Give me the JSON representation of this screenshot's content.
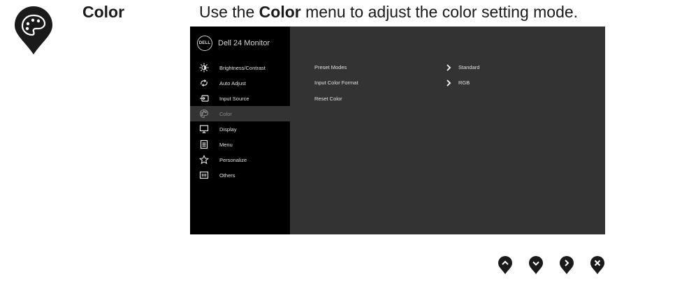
{
  "heading": {
    "title": "Color",
    "desc_before": "Use the ",
    "desc_bold": "Color",
    "desc_after": " menu to adjust the color setting mode."
  },
  "osd": {
    "logo_text": "DELL",
    "title": "Dell 24 Monitor",
    "menu": [
      {
        "label": "Brightness/Contrast",
        "icon": "brightness-icon",
        "active": false
      },
      {
        "label": "Auto Adjust",
        "icon": "auto-adjust-icon",
        "active": false
      },
      {
        "label": "Input Source",
        "icon": "input-source-icon",
        "active": false
      },
      {
        "label": "Color",
        "icon": "palette-icon",
        "active": true
      },
      {
        "label": "Display",
        "icon": "display-icon",
        "active": false
      },
      {
        "label": "Menu",
        "icon": "menu-icon",
        "active": false
      },
      {
        "label": "Personalize",
        "icon": "star-icon",
        "active": false
      },
      {
        "label": "Others",
        "icon": "others-icon",
        "active": false
      }
    ],
    "panel": [
      {
        "label": "Preset Modes",
        "value": "Standard",
        "has_arrow": true
      },
      {
        "label": "Input Color Format",
        "value": "RGB",
        "has_arrow": true
      },
      {
        "label": "Reset Color",
        "value": "",
        "has_arrow": false
      }
    ]
  },
  "nav_buttons": [
    "up-button",
    "down-button",
    "right-button",
    "close-button"
  ],
  "colors": {
    "osd_sidebar": "#000000",
    "osd_panel": "#333333",
    "pin": "#1a1a1a"
  }
}
